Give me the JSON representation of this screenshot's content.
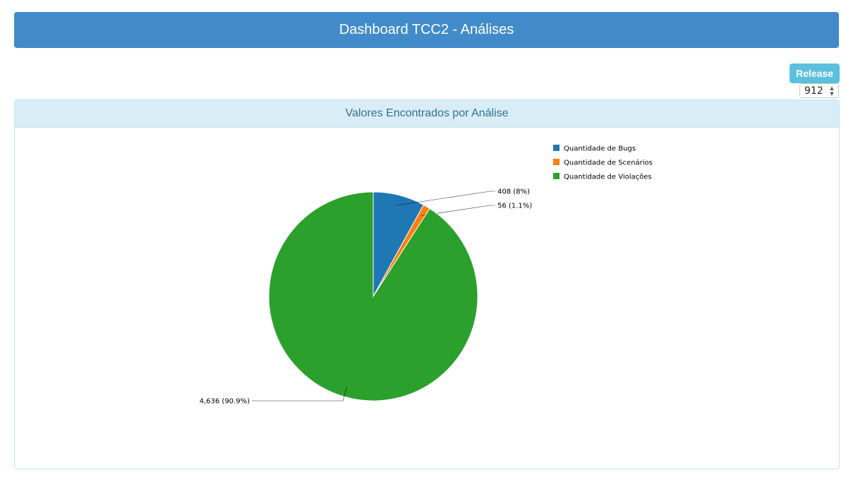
{
  "header": {
    "title": "Dashboard TCC2 - Análises"
  },
  "release": {
    "label": "Release",
    "value": "912"
  },
  "panel": {
    "title": "Valores Encontrados por Análise"
  },
  "chart_data": {
    "type": "pie",
    "title": "",
    "legend_position": "top-right",
    "slices": [
      {
        "label": "Quantidade de Bugs",
        "value": 408,
        "percent": "8%",
        "display": "408 (8%)",
        "color": "#1f77b4"
      },
      {
        "label": "Quantidade de Scenários",
        "value": 56,
        "percent": "1.1%",
        "display": "56 (1.1%)",
        "color": "#ff7f0e"
      },
      {
        "label": "Quantidade de Violações",
        "value": 4636,
        "percent": "90.9%",
        "display": "4,636 (90.9%)",
        "color": "#2ca02c"
      }
    ]
  }
}
